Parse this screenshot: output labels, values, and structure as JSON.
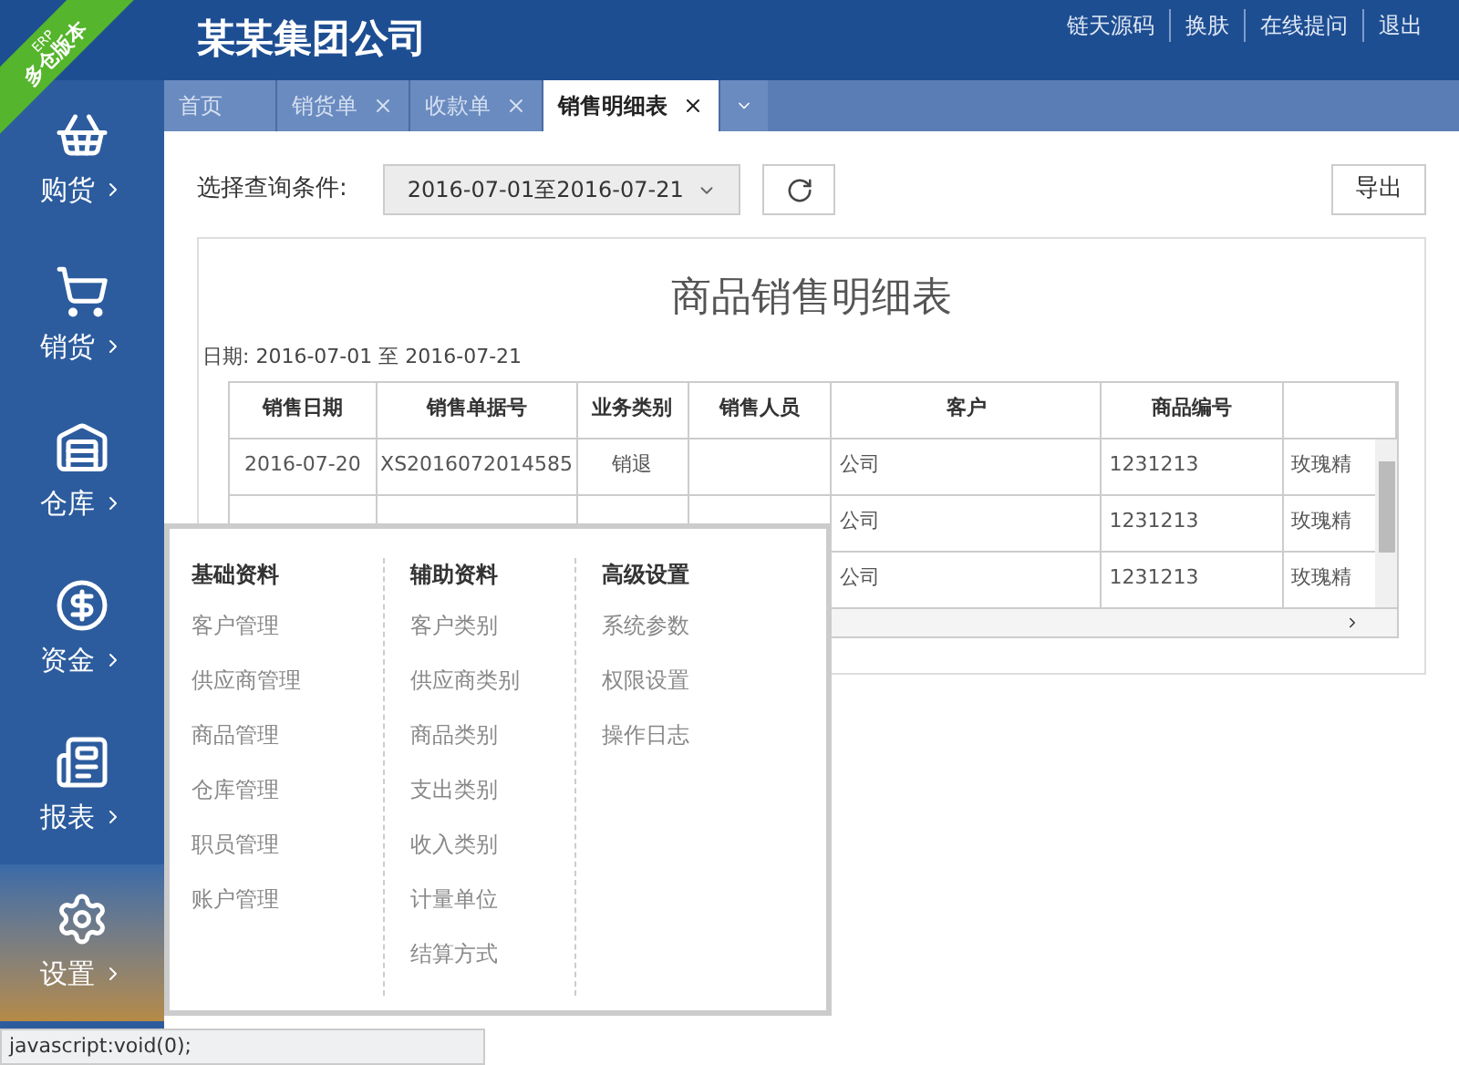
{
  "ribbon": {
    "small": "ERP",
    "label": "多仓版本"
  },
  "header": {
    "title": "某某集团公司",
    "links": [
      "链天源码",
      "换肤",
      "在线提问",
      "退出"
    ]
  },
  "sidebar": {
    "items": [
      {
        "label": "购货",
        "selected": false
      },
      {
        "label": "销货",
        "selected": false
      },
      {
        "label": "仓库",
        "selected": false
      },
      {
        "label": "资金",
        "selected": false
      },
      {
        "label": "报表",
        "selected": false
      },
      {
        "label": "设置",
        "selected": true
      }
    ]
  },
  "tabs": [
    {
      "label": "首页",
      "closable": false,
      "selected": false
    },
    {
      "label": "销货单",
      "closable": true,
      "selected": false
    },
    {
      "label": "收款单",
      "closable": true,
      "selected": false
    },
    {
      "label": "销售明细表",
      "closable": true,
      "selected": true
    }
  ],
  "toolbar": {
    "filter_label": "选择查询条件:",
    "date_range": "2016-07-01至2016-07-21",
    "export": "导出"
  },
  "report": {
    "title": "商品销售明细表",
    "date_line": "日期: 2016-07-01 至 2016-07-21",
    "columns": [
      "销售日期",
      "销售单据号",
      "业务类别",
      "销售人员",
      "客户",
      "商品编号",
      ""
    ],
    "rows": [
      {
        "cells": [
          "2016-07-20",
          "XS2016072014585",
          "销退",
          "",
          "公司",
          "1231213",
          "玫瑰精"
        ]
      },
      {
        "cells": [
          null,
          null,
          null,
          null,
          "公司",
          "1231213",
          "玫瑰精"
        ]
      },
      {
        "cells": [
          null,
          null,
          null,
          null,
          "公司",
          "1231213",
          "玫瑰精"
        ]
      }
    ]
  },
  "menu": {
    "columns": [
      {
        "heading": "基础资料",
        "items": [
          "客户管理",
          "供应商管理",
          "商品管理",
          "仓库管理",
          "职员管理",
          "账户管理"
        ]
      },
      {
        "heading": "辅助资料",
        "items": [
          "客户类别",
          "供应商类别",
          "商品类别",
          "支出类别",
          "收入类别",
          "计量单位",
          "结算方式"
        ]
      },
      {
        "heading": "高级设置",
        "items": [
          "系统参数",
          "权限设置",
          "操作日志"
        ]
      }
    ]
  },
  "status_bar": {
    "text": "javascript:void(0);"
  }
}
